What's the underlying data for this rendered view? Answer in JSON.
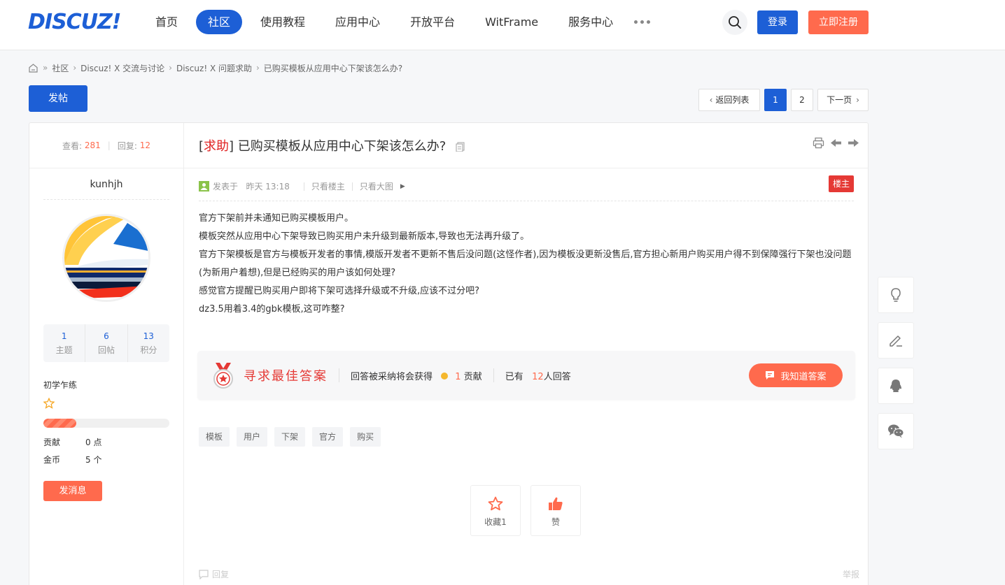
{
  "header": {
    "logo": "DISCUZ!",
    "nav": [
      "首页",
      "社区",
      "使用教程",
      "应用中心",
      "开放平台",
      "WitFrame",
      "服务中心"
    ],
    "login": "登录",
    "register": "立即注册"
  },
  "breadcrumb": [
    "»",
    "社区",
    "Discuz! X 交流与讨论",
    "Discuz! X 问题求助",
    "已购买模板从应用中心下架该怎么办?"
  ],
  "toolbar": {
    "post_button": "发帖",
    "back_to_list": "返回列表",
    "pages": [
      "1",
      "2"
    ],
    "next_page": "下一页"
  },
  "thread": {
    "views_label": "查看:",
    "views": "281",
    "replies_label": "回复:",
    "replies": "12",
    "tag": "求助",
    "title": "已购买模板从应用中心下架该怎么办?"
  },
  "author": {
    "name": "kunhjh",
    "topics": "1",
    "topics_label": "主题",
    "posts": "6",
    "posts_label": "回帖",
    "credits": "13",
    "credits_label": "积分",
    "level": "初学乍练",
    "level_progress": 0.26,
    "contribution_label": "贡献",
    "contribution": "0 点",
    "gold_label": "金币",
    "gold": "5 个",
    "message_button": "发消息"
  },
  "post": {
    "posted_label": "发表于",
    "posted_time": "昨天 13:18",
    "only_owner": "只看楼主",
    "only_images": "只看大图",
    "owner_badge": "楼主",
    "paragraphs": [
      "官方下架前并未通知已购买模板用户。",
      "模板突然从应用中心下架导致已购买用户未升级到最新版本,导致也无法再升级了。",
      "官方下架模板是官方与模板开发者的事情,模版开发者不更新不售后没问题(这怪作者),因为模板没更新没售后,官方担心新用户购买用户得不到保障强行下架也没问题(为新用户着想),但是已经购买的用户该如何处理?",
      "感觉官方提醒已购买用户即将下架可选择升级或不升级,应该不过分吧?",
      "dz3.5用着3.4的gbk模板,这可咋整?"
    ]
  },
  "answer": {
    "title": "寻求最佳答案",
    "reward_text": "回答被采纳将会获得",
    "reward_amount": "1",
    "reward_unit": "贡献",
    "answered_prefix": "已有",
    "answered_count": "12",
    "answered_suffix": "人回答",
    "button": "我知道答案"
  },
  "tags": [
    "模板",
    "用户",
    "下架",
    "官方",
    "购买"
  ],
  "actions": {
    "favorite": "收藏1",
    "like": "赞"
  },
  "footer": {
    "reply": "回复",
    "report": "举报"
  },
  "colors": {
    "primary": "#1d5fd6",
    "accent": "#ff6a4d",
    "danger": "#e53935"
  }
}
